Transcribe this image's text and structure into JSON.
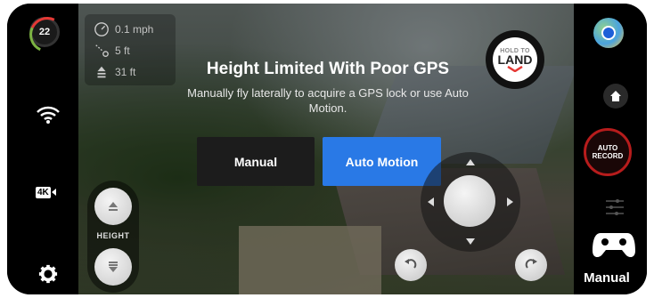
{
  "status": {
    "battery_value": "22"
  },
  "telemetry": {
    "speed": "0.1 mph",
    "distance": "5 ft",
    "altitude": "31 ft",
    "speed_icon": "speedometer-icon",
    "distance_icon": "distance-icon",
    "altitude_icon": "altitude-icon"
  },
  "left_panel": {
    "wifi_icon": "wifi-icon",
    "resolution_badge": "4K",
    "settings_icon": "gear-icon"
  },
  "height_control": {
    "label": "HEIGHT",
    "up_icon": "ascend-icon",
    "down_icon": "descend-icon"
  },
  "dialog": {
    "title": "Height Limited With Poor GPS",
    "message": "Manually fly laterally to acquire a GPS lock or use Auto Motion.",
    "manual_button": "Manual",
    "auto_button": "Auto Motion",
    "auto_button_color": "#2979e6"
  },
  "land": {
    "hold_label": "HOLD TO",
    "label": "LAND",
    "accent_color": "#e53935"
  },
  "right_panel": {
    "map_icon": "map-icon",
    "home_icon": "home-icon",
    "auto_record_line1": "AUTO",
    "auto_record_line2": "RECORD",
    "auto_record_color": "#b71c1c",
    "sliders_icon": "sliders-icon",
    "mode_icon": "gamepad-icon",
    "mode_label": "Manual"
  }
}
